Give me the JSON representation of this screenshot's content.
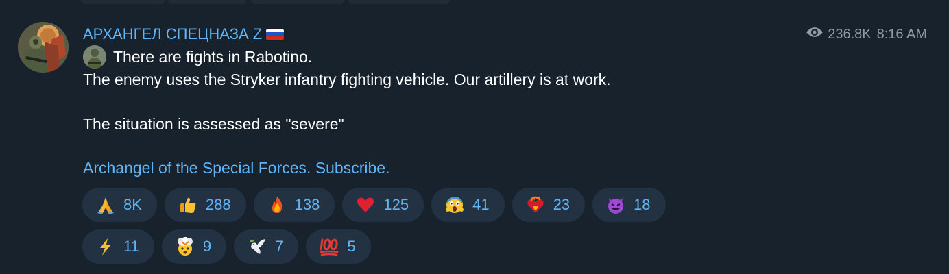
{
  "message": {
    "channel_name": "АРХАНГЕЛ СПЕЦНАЗА Z",
    "channel_flag": "russia-flag",
    "views": "236.8K",
    "time": "8:16 AM",
    "lines": [
      "There are fights in Rabotino.",
      "The enemy uses the Stryker infantry fighting vehicle. Our artillery is at work.",
      "",
      "The situation is assessed as \"severe\""
    ],
    "subscribe_link": "Archangel of the Special Forces. Subscribe."
  },
  "reactions": [
    {
      "emoji": "folded-hands",
      "count": "8K"
    },
    {
      "emoji": "thumbs-up",
      "count": "288"
    },
    {
      "emoji": "fire",
      "count": "138"
    },
    {
      "emoji": "red-heart",
      "count": "125"
    },
    {
      "emoji": "screaming-face",
      "count": "41"
    },
    {
      "emoji": "heart-on-fire",
      "count": "23"
    },
    {
      "emoji": "smiling-devil",
      "count": "18"
    },
    {
      "emoji": "lightning",
      "count": "11"
    },
    {
      "emoji": "exploding-head",
      "count": "9"
    },
    {
      "emoji": "dove",
      "count": "7"
    },
    {
      "emoji": "hundred-points",
      "count": "5"
    }
  ],
  "colors": {
    "background": "#18222d",
    "accent": "#5eb5f7",
    "meta": "#8d9aa7",
    "chip": "#233243"
  }
}
